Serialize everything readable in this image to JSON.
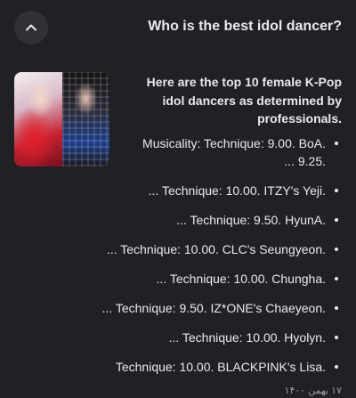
{
  "header": {
    "question": "Who is the best idol dancer?",
    "collapse_icon": "chevron-up-icon"
  },
  "snippet": {
    "intro": "Here are the top 10 female K-Pop idol dancers as determined by professionals.",
    "items": [
      {
        "text": "Musicality: Technique: 9.00. BoA. ... 9.25."
      },
      {
        "text": "... Technique: 10.00. ITZY's Yeji."
      },
      {
        "text": "... Technique: 9.50. HyunA."
      },
      {
        "text": "... Technique: 10.00. CLC's Seungyeon."
      },
      {
        "text": "... Technique: 10.00. Chungha."
      },
      {
        "text": "... Technique: 9.50. IZ*ONE's Chaeyeon."
      },
      {
        "text": "... Technique: 10.00. Hyolyn."
      },
      {
        "text": "Technique: 10.00. BLACKPINK's Lisa."
      }
    ],
    "date": "۱۷ بهمن ۱۴۰۰"
  },
  "colors": {
    "background": "#202124",
    "text": "#e8eaed",
    "button_bg": "#303134",
    "muted": "#9aa0a6"
  }
}
